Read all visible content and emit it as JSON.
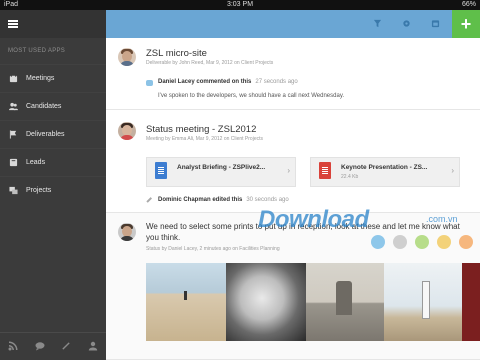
{
  "status_bar": {
    "carrier": "iPad",
    "time": "3:03 PM",
    "battery": "66%"
  },
  "sidebar": {
    "heading": "MOST USED APPS",
    "items": [
      {
        "label": "Meetings",
        "icon": "calendar-icon"
      },
      {
        "label": "Candidates",
        "icon": "people-icon"
      },
      {
        "label": "Deliverables",
        "icon": "flag-icon"
      },
      {
        "label": "Leads",
        "icon": "book-icon"
      },
      {
        "label": "Projects",
        "icon": "projects-icon"
      }
    ],
    "bottom_icons": [
      "rss-icon",
      "chat-icon",
      "tools-icon",
      "user-add-icon"
    ]
  },
  "topbar": {
    "add_label": "+"
  },
  "posts": [
    {
      "title": "ZSL micro-site",
      "meta": "Deliverable by John Reed, Mar 9, 2012 on Client Projects",
      "comment_author": "Daniel Lacey commented on this",
      "comment_time": "27 seconds ago",
      "comment_text": "I've spoken to the developers, we should have a call next Wednesday."
    },
    {
      "title": "Status meeting - ZSL2012",
      "meta": "Meeting by Emma Ali, Mar 9, 2012 on Client Projects",
      "attachments": [
        {
          "name": "Analyst Briefing - ZSPlive2...",
          "size": "",
          "color": "#3d7dd1"
        },
        {
          "name": "Keynote Presentation - ZS...",
          "size": "22.4 Kb",
          "color": "#d9423a"
        }
      ],
      "edit_author": "Dominic Chapman edited this",
      "edit_time": "30 seconds ago"
    },
    {
      "text": "We need to select some prints to put up in reception, look at these and let me know what you think.",
      "meta": "Status by Daniel Lacey, 2 minutes ago on Facilities Planning"
    }
  ],
  "watermark": {
    "main": "Download",
    "sub": ".com.vn"
  },
  "color_dots": [
    "#8ec7ea",
    "#cfcfcf",
    "#b7dd8a",
    "#f3d27a",
    "#f6b77e",
    "#6fa6d9",
    "#f08a8a"
  ]
}
